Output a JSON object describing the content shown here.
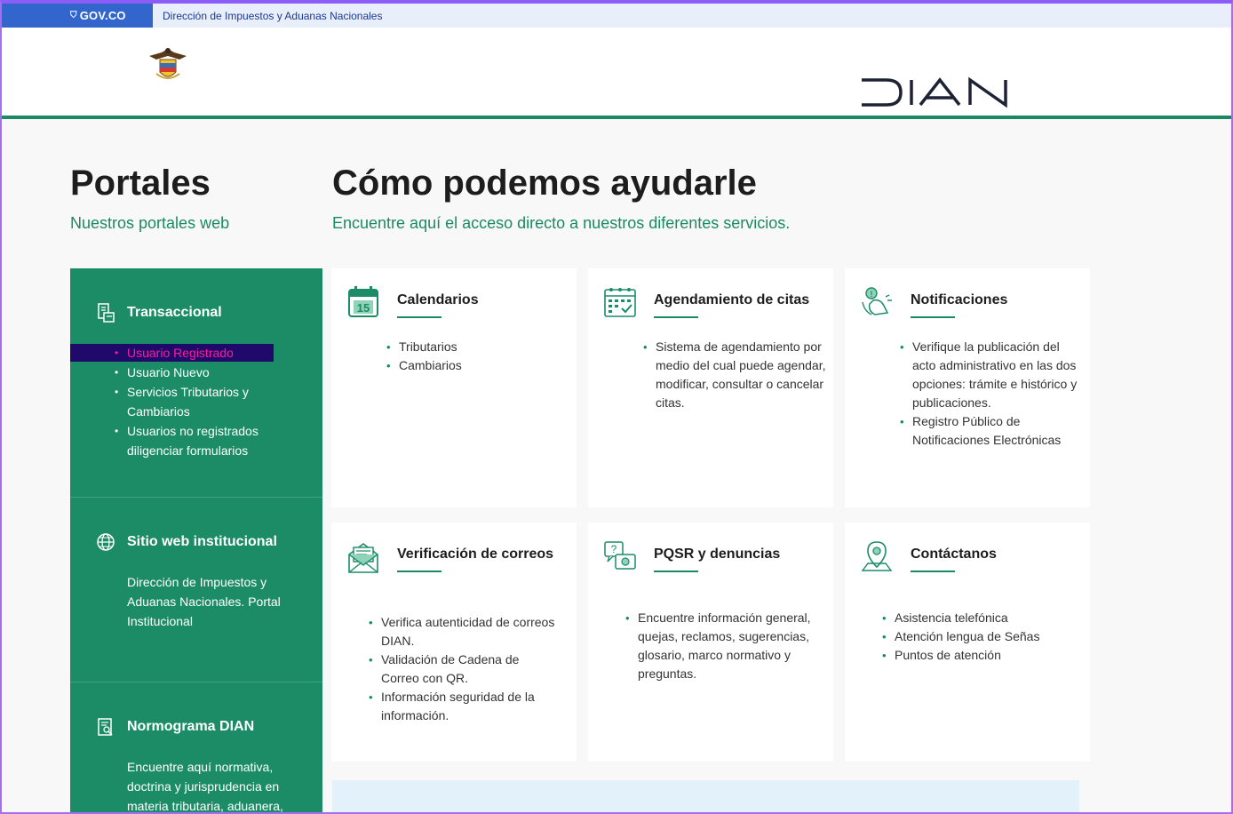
{
  "govbar": {
    "logo_text": "GOV.CO",
    "link_text": "Dirección de Impuestos y Aduanas Nacionales"
  },
  "header": {
    "brand": "DIAN"
  },
  "portales": {
    "title": "Portales",
    "subtitle": "Nuestros portales web",
    "sections": [
      {
        "title": "Transaccional",
        "items": [
          "Usuario Registrado",
          "Usuario Nuevo",
          "Servicios Tributarios y Cambiarios",
          "Usuarios no registrados diligenciar formularios"
        ]
      },
      {
        "title": "Sitio web institucional",
        "text": "Dirección de Impuestos y Aduanas Nacionales. Portal Institucional"
      },
      {
        "title": "Normograma DIAN",
        "text": "Encuentre aquí normativa, doctrina y jurisprudencia en materia tributaria, aduanera,"
      }
    ]
  },
  "ayuda": {
    "title": "Cómo podemos ayudarle",
    "subtitle": "Encuentre aquí el acceso directo a nuestros diferentes servicios.",
    "cards": [
      {
        "title": "Calendarios",
        "icon": "calendar-icon",
        "items": [
          "Tributarios",
          "Cambiarios"
        ]
      },
      {
        "title": "Agendamiento de citas",
        "icon": "appointment-icon",
        "items": [
          "Sistema de agendamiento por medio del cual puede agendar, modificar, consultar o cancelar citas."
        ]
      },
      {
        "title": "Notificaciones",
        "icon": "notification-icon",
        "items": [
          "Verifique la publicación del acto administrativo en las dos opciones: trámite e histórico y publicaciones.",
          "Registro Público de Notificaciones Electrónicas"
        ]
      },
      {
        "title": "Verificación de correos",
        "icon": "mail-check-icon",
        "items": [
          "Verifica autenticidad de correos DIAN.",
          "Validación de Cadena de Correo con QR.",
          "Información seguridad de la información."
        ]
      },
      {
        "title": "PQSR y denuncias",
        "icon": "pqsr-icon",
        "items": [
          "Encuentre información general, quejas, reclamos, sugerencias, glosario, marco normativo y preguntas."
        ]
      },
      {
        "title": "Contáctanos",
        "icon": "location-icon",
        "items": [
          "Asistencia telefónica",
          "Atención lengua de Señas",
          "Puntos de atención"
        ]
      }
    ]
  },
  "bottom": {
    "title": ""
  },
  "colors": {
    "brand_green": "#1b8c66",
    "gov_blue": "#3366cc",
    "highlight": "#ff1a9a"
  }
}
